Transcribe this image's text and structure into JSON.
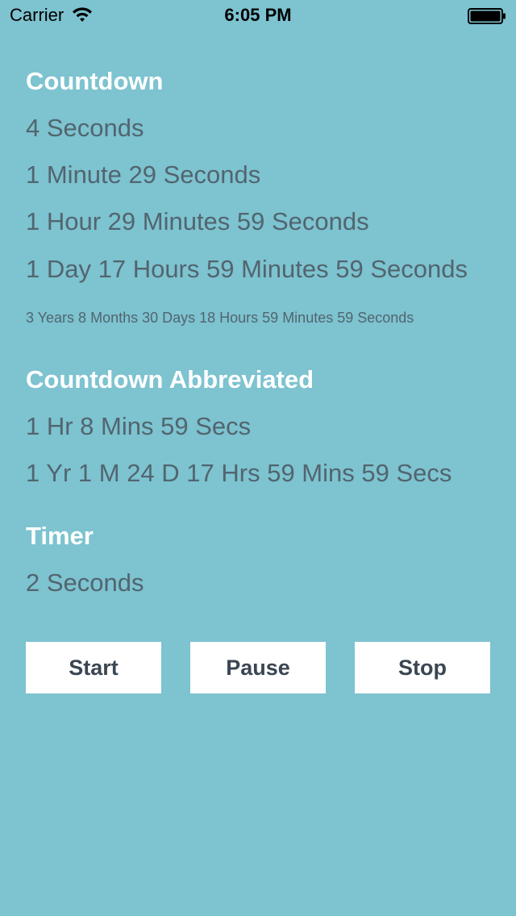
{
  "status_bar": {
    "carrier": "Carrier",
    "time": "6:05 PM"
  },
  "sections": {
    "countdown": {
      "title": "Countdown",
      "lines": [
        "4 Seconds",
        "1 Minute 29 Seconds",
        "1 Hour 29 Minutes 59 Seconds",
        "1 Day 17 Hours 59 Minutes 59 Seconds",
        "3 Years 8 Months 30 Days 18 Hours 59 Minutes 59 Seconds"
      ]
    },
    "countdown_abbreviated": {
      "title": "Countdown Abbreviated",
      "lines": [
        "1 Hr 8 Mins 59 Secs",
        "1 Yr 1 M 24 D 17 Hrs 59 Mins 59 Secs"
      ]
    },
    "timer": {
      "title": "Timer",
      "lines": [
        "2 Seconds"
      ]
    }
  },
  "buttons": {
    "start": "Start",
    "pause": "Pause",
    "stop": "Stop"
  },
  "colors": {
    "background": "#7dc3d0",
    "title_text": "#ffffff",
    "body_text": "#52656f",
    "button_bg": "#ffffff",
    "button_text": "#3a4652"
  }
}
